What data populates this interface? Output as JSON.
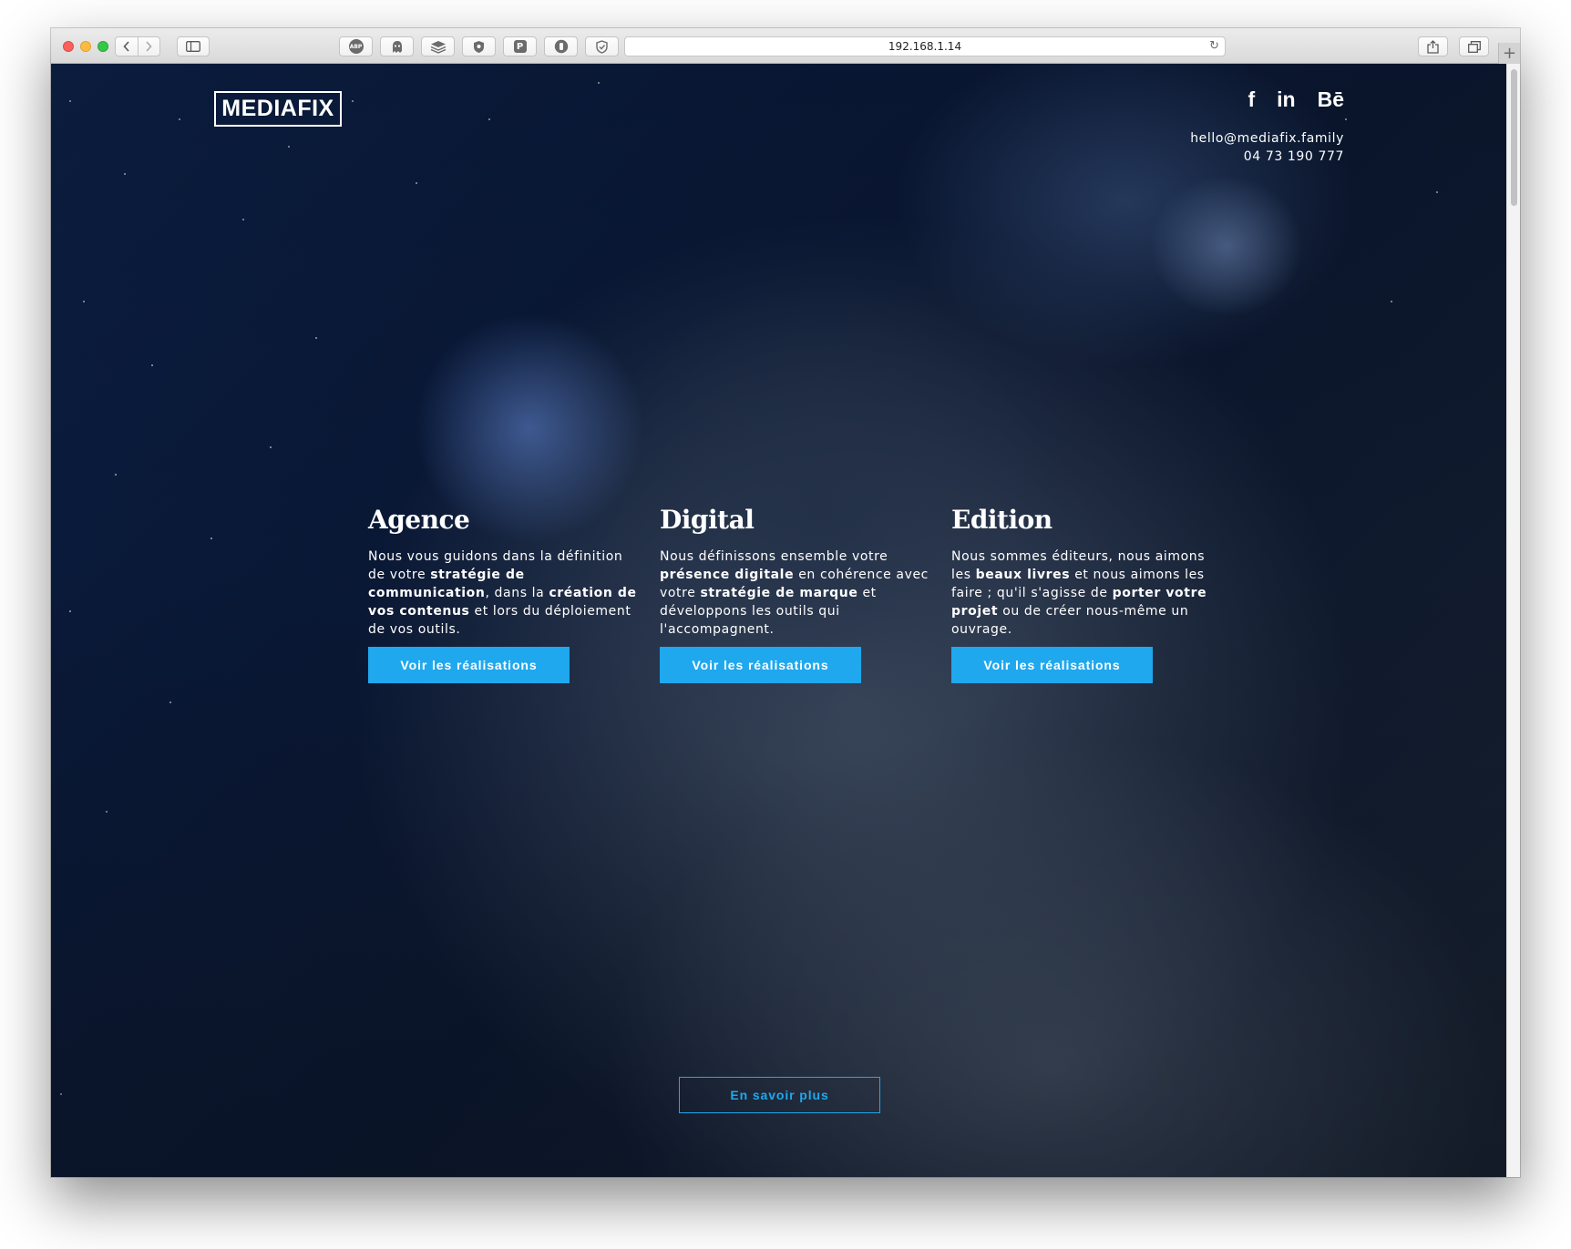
{
  "browser": {
    "url": "192.168.1.14",
    "extensions": [
      "ABP",
      "ghostery",
      "buffer",
      "shield",
      "P",
      "lastpass",
      "privacy-badger"
    ]
  },
  "header": {
    "logo": "MEDIAFIX",
    "social": {
      "facebook": "f",
      "linkedin": "in",
      "behance": "Bē"
    },
    "email": "hello@mediafix.family",
    "phone": "04 73 190 777"
  },
  "sections": [
    {
      "title": "Agence",
      "text": [
        {
          "t": "Nous vous guidons dans la définition de votre ",
          "b": false
        },
        {
          "t": "stratégie de communication",
          "b": true
        },
        {
          "t": ", dans la ",
          "b": false
        },
        {
          "t": "création de vos contenus",
          "b": true
        },
        {
          "t": " et lors du déploiement de vos outils.",
          "b": false
        }
      ],
      "button": "Voir les réalisations"
    },
    {
      "title": "Digital",
      "text": [
        {
          "t": "Nous définissons ensemble votre ",
          "b": false
        },
        {
          "t": "présence digitale",
          "b": true
        },
        {
          "t": " en cohérence avec votre ",
          "b": false
        },
        {
          "t": "stratégie de marque",
          "b": true
        },
        {
          "t": " et développons les outils qui l'accompagnent.",
          "b": false
        }
      ],
      "button": "Voir les réalisations"
    },
    {
      "title": "Edition",
      "text": [
        {
          "t": "Nous sommes éditeurs, nous aimons les ",
          "b": false
        },
        {
          "t": "beaux livres",
          "b": true
        },
        {
          "t": " et nous aimons les faire ; qu'il s'agisse de ",
          "b": false
        },
        {
          "t": "porter votre projet",
          "b": true
        },
        {
          "t": " ou de créer nous-même un ouvrage.",
          "b": false
        }
      ],
      "button": "Voir les réalisations"
    }
  ],
  "more_button": "En savoir plus",
  "colors": {
    "accent": "#1fa8ee",
    "text": "#ffffff",
    "background": "#0b1426"
  }
}
